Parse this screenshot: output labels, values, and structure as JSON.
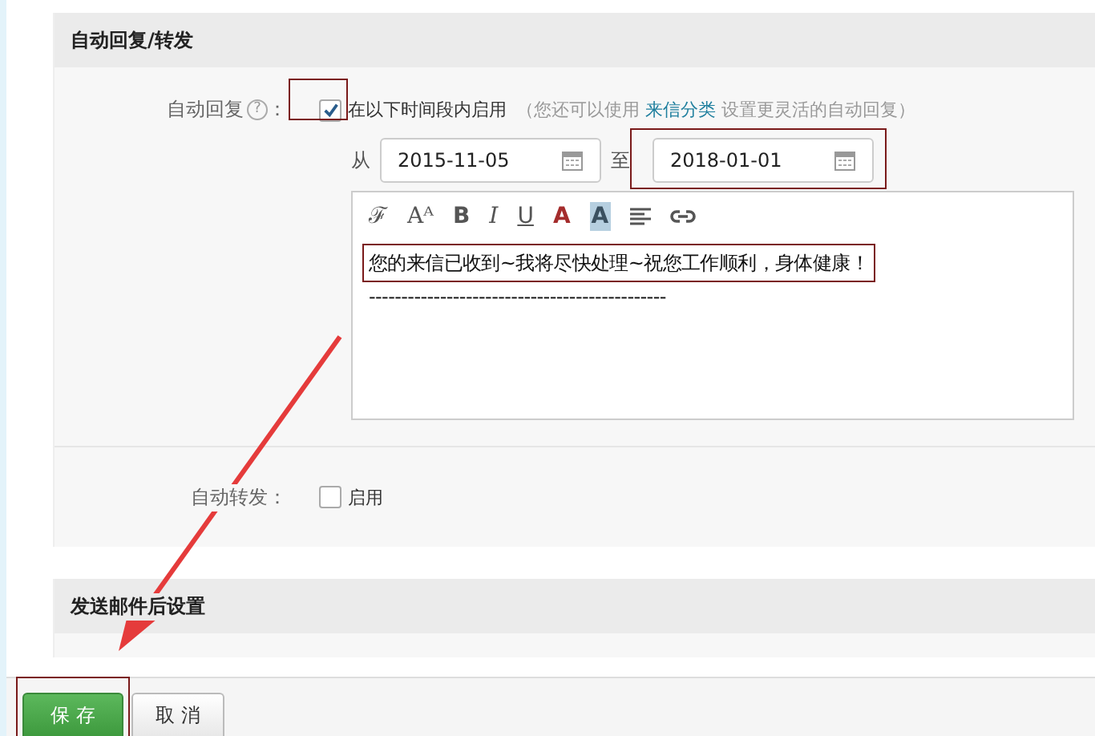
{
  "auto_section": {
    "title": "自动回复/转发",
    "auto_reply": {
      "label": "自动回复",
      "help": "?",
      "colon": "：",
      "checked": true,
      "enable_text": "在以下时间段内启用",
      "hint_before": "（您还可以使用",
      "hint_link": "来信分类",
      "hint_after": "设置更灵活的自动回复）"
    },
    "date_range": {
      "from_label": "从",
      "from": "2015-11-05",
      "to_label": "至",
      "to": "2018-01-01"
    },
    "toolbar": [
      {
        "kind": "glyph",
        "label": "ℱ"
      },
      {
        "kind": "glyph",
        "label": "Aᴬ"
      },
      {
        "kind": "bold",
        "label": "B"
      },
      {
        "kind": "italic",
        "label": "I"
      },
      {
        "kind": "underline",
        "label": "U"
      },
      {
        "kind": "color",
        "label": "A"
      },
      {
        "kind": "highlight",
        "label": "A"
      },
      {
        "kind": "align"
      },
      {
        "kind": "link"
      }
    ],
    "editor_lines": [
      "您的来信已收到~我将尽快处理~祝您工作顺利，身体健康！",
      "----------------------------------------------"
    ],
    "auto_forward": {
      "label": "自动转发：",
      "checked": false,
      "text": "启用"
    }
  },
  "send_section": {
    "title": "发送邮件后设置"
  },
  "buttons": [
    {
      "kind": "primary",
      "label": "保 存"
    },
    {
      "kind": "default",
      "label": "取 消"
    }
  ]
}
